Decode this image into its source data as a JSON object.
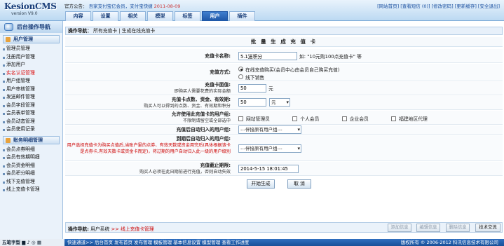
{
  "app": {
    "logo": "KesionCMS",
    "version": "version V9.0"
  },
  "notice": {
    "label": "官方公告：",
    "text": "吾家支付宝亿会员，支付宝快捷",
    "date": "2011-08-09"
  },
  "toplinks": "[网站首页] [查看短信 (0)] [修改密码] [更新缓存] [安全退出]",
  "tabs": [
    {
      "label": "内容"
    },
    {
      "label": "设置"
    },
    {
      "label": "相关"
    },
    {
      "label": "模型"
    },
    {
      "label": "标签"
    },
    {
      "label": "用户"
    },
    {
      "label": "插件"
    }
  ],
  "sidebar": {
    "title": "后台操作导航",
    "group1": "用户管理",
    "items1": [
      "管理员管理",
      "注册用户管理",
      "添加用户",
      "实名认证管理",
      "用户组管理",
      "用户审核管理",
      "发送邮件管理",
      "会员字段管理",
      "会员表单管理",
      "会员动态管理",
      "会员使用记录"
    ],
    "group2": "账务明细管理",
    "items2": [
      "会员点券明细",
      "会员有效期明细",
      "会员资金明细",
      "会员积分明细",
      "线下充值管理",
      "线上充值卡管理"
    ]
  },
  "crumb": {
    "label": "操作导航：",
    "p1": "所有充值卡",
    "sep": "|",
    "p2": "生成在线充值卡"
  },
  "form": {
    "title": "批 量 生 成 充 值 卡",
    "name_label": "充值卡名称:",
    "name_value": "5.1送积分",
    "name_hint": "如: \"10元购100点充值卡\" 等",
    "mode_label": "充值方式:",
    "mode_opt1": "在线充值购买(会员中心由会员自己购买充值)",
    "mode_opt2": "线下销售",
    "price_label": "充值卡面值:",
    "price_sub": "即购买人需要花费的实际金额",
    "price_value": "50",
    "price_unit": "元",
    "points_label": "充值卡点数、资金、有效期:",
    "points_sub": "购买人可以得到的点数、资金、有效期和积分",
    "points_value": "50",
    "points_unit": "元",
    "groups_label": "允许使用此充值卡的用户组:",
    "groups_sub": "不限制请留空或全部选中",
    "groups": [
      "网站管理员",
      "个人会员",
      "企业会员",
      "福建地区代理"
    ],
    "after_label": "充值后自动归入的用户组:",
    "after_select": "---伴接原有用户组---",
    "expire_label": "到期后自动归入的用户组:",
    "expire_sub": "用户选择充值卡为购买点值后,当账户里的点券、有效天数或资金用完后(具体根据该卡是点券卡,有效天数卡或资金卡而定)，将过期的用户自动归入此一级的用户级别",
    "expire_select": "---伴接原有用户组---",
    "deadline_label": "充值截止期限:",
    "deadline_sub": "购买人必须在此日期前进行充值，否则自动失效",
    "deadline_value": "2014-5-15 18:01:45",
    "submit": "开始生成",
    "cancel": "取 消"
  },
  "bottom": {
    "label": "操作导航:",
    "p1": "用户系统",
    "arrow": ">>",
    "p2": "线上充值卡管理",
    "btn_add": "添加信息",
    "btn_edit": "编辑信息",
    "btn_del": "删除信息",
    "btn_support": "技术交流"
  },
  "status": {
    "ime": "五笔字型 ▆ ♪ ◎ ▦",
    "links": "快速通道>> 后台首页 发布首页 发布管理 模板管理 基本信息设置 模型管理 查看工作进度",
    "copyright": "版权所有 © 2006-2012 科汛信息技术有限公司"
  }
}
